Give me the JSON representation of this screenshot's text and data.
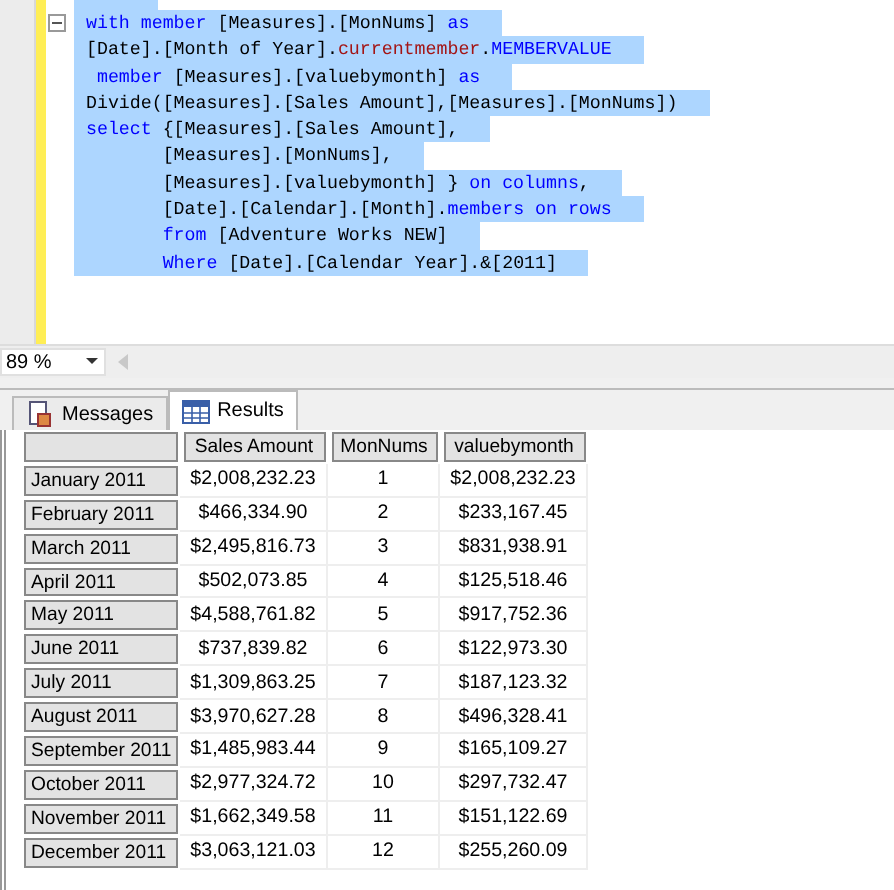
{
  "editor": {
    "lines": [
      {
        "selected": true,
        "collapsible": false
      },
      {
        "selected": true,
        "collapsible": true,
        "tokens": [
          {
            "kind": "keyword",
            "text": "with member"
          },
          {
            "kind": "plain",
            "text": " [Measures].[MonNums] "
          },
          {
            "kind": "keyword",
            "text": "as"
          }
        ]
      },
      {
        "selected": true,
        "collapsible": false,
        "tokens": [
          {
            "kind": "plain",
            "text": "[Date].[Month of Year]."
          },
          {
            "kind": "function",
            "text": "currentmember"
          },
          {
            "kind": "plain",
            "text": "."
          },
          {
            "kind": "keyword",
            "text": "MEMBERVALUE"
          }
        ]
      },
      {
        "selected": true,
        "collapsible": false,
        "tokens": [
          {
            "kind": "keyword",
            "text": " member"
          },
          {
            "kind": "plain",
            "text": " [Measures].[valuebymonth] "
          },
          {
            "kind": "keyword",
            "text": "as"
          }
        ]
      },
      {
        "selected": true,
        "collapsible": false,
        "tokens": [
          {
            "kind": "plain",
            "text": "Divide([Measures].[Sales Amount],[Measures].[MonNums])"
          }
        ]
      },
      {
        "selected": true,
        "collapsible": false,
        "tokens": [
          {
            "kind": "keyword",
            "text": "select"
          },
          {
            "kind": "plain",
            "text": " {[Measures].[Sales Amount],"
          }
        ]
      },
      {
        "selected": true,
        "collapsible": false,
        "tokens": [
          {
            "kind": "plain",
            "text": "       [Measures].[MonNums],"
          }
        ]
      },
      {
        "selected": true,
        "collapsible": false,
        "tokens": [
          {
            "kind": "plain",
            "text": "       [Measures].[valuebymonth] } "
          },
          {
            "kind": "keyword",
            "text": "on columns"
          },
          {
            "kind": "plain",
            "text": ","
          }
        ]
      },
      {
        "selected": true,
        "collapsible": false,
        "tokens": [
          {
            "kind": "plain",
            "text": "       [Date].[Calendar].[Month]."
          },
          {
            "kind": "keyword",
            "text": "members on rows"
          }
        ]
      },
      {
        "selected": true,
        "collapsible": false,
        "tokens": [
          {
            "kind": "keyword",
            "text": "       from"
          },
          {
            "kind": "plain",
            "text": " [Adventure Works NEW]"
          }
        ]
      },
      {
        "selected": true,
        "collapsible": false,
        "tokens": [
          {
            "kind": "keyword",
            "text": "       Where"
          },
          {
            "kind": "plain",
            "text": " [Date].[Calendar Year].&[2011]"
          }
        ]
      }
    ]
  },
  "zoom": {
    "value": "89 %"
  },
  "tabs": [
    {
      "label": "Messages",
      "kind": "messages",
      "selected": false
    },
    {
      "label": "Results",
      "kind": "grid",
      "selected": true
    }
  ],
  "table": {
    "columns": [
      "Sales Amount",
      "MonNums",
      "valuebymonth"
    ],
    "rows": [
      {
        "header": "January 2011",
        "cells": [
          "$2,008,232.23",
          "1",
          "$2,008,232.23"
        ]
      },
      {
        "header": "February 2011",
        "cells": [
          "$466,334.90",
          "2",
          "$233,167.45"
        ]
      },
      {
        "header": "March 2011",
        "cells": [
          "$2,495,816.73",
          "3",
          "$831,938.91"
        ]
      },
      {
        "header": "April 2011",
        "cells": [
          "$502,073.85",
          "4",
          "$125,518.46"
        ]
      },
      {
        "header": "May 2011",
        "cells": [
          "$4,588,761.82",
          "5",
          "$917,752.36"
        ]
      },
      {
        "header": "June 2011",
        "cells": [
          "$737,839.82",
          "6",
          "$122,973.30"
        ]
      },
      {
        "header": "July 2011",
        "cells": [
          "$1,309,863.25",
          "7",
          "$187,123.32"
        ]
      },
      {
        "header": "August 2011",
        "cells": [
          "$3,970,627.28",
          "8",
          "$496,328.41"
        ]
      },
      {
        "header": "September 2011",
        "cells": [
          "$1,485,983.44",
          "9",
          "$165,109.27"
        ]
      },
      {
        "header": "October 2011",
        "cells": [
          "$2,977,324.72",
          "10",
          "$297,732.47"
        ]
      },
      {
        "header": "November 2011",
        "cells": [
          "$1,662,349.58",
          "11",
          "$151,122.69"
        ]
      },
      {
        "header": "December 2011",
        "cells": [
          "$3,063,121.03",
          "12",
          "$255,260.09"
        ]
      }
    ]
  }
}
